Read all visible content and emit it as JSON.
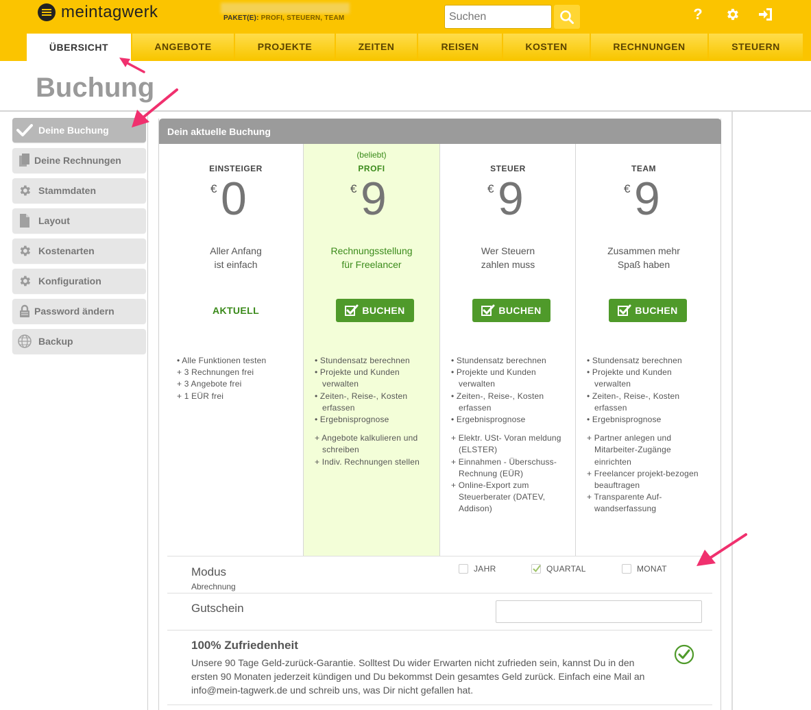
{
  "header": {
    "logo_text": "meintagwerk",
    "paket_label": "PAKET(E):",
    "paket_value": "PROFI, STEUERN, TEAM",
    "search_placeholder": "Suchen",
    "icons": [
      "help-icon",
      "gear-icon",
      "logout-icon"
    ],
    "accent_color": "#fbc400"
  },
  "nav": {
    "tabs": [
      {
        "label": "ÜBERSICHT",
        "active": true
      },
      {
        "label": "ANGEBOTE"
      },
      {
        "label": "PROJEKTE"
      },
      {
        "label": "ZEITEN"
      },
      {
        "label": "REISEN"
      },
      {
        "label": "KOSTEN"
      },
      {
        "label": "RECHNUNGEN"
      },
      {
        "label": "STEUERN"
      }
    ]
  },
  "page": {
    "title": "Buchung"
  },
  "sidebar": {
    "items": [
      {
        "label": "Deine Buchung",
        "icon": "check-icon",
        "active": true
      },
      {
        "label": "Deine Rechnungen",
        "icon": "invoices-icon"
      },
      {
        "label": "Stammdaten",
        "icon": "gear-icon"
      },
      {
        "label": "Layout",
        "icon": "document-icon"
      },
      {
        "label": "Kostenarten",
        "icon": "gear-icon"
      },
      {
        "label": "Konfiguration",
        "icon": "gear-icon"
      },
      {
        "label": "Password ändern",
        "icon": "lock-icon"
      },
      {
        "label": "Backup",
        "icon": "globe-icon"
      }
    ]
  },
  "panel": {
    "title": "Dein aktuelle Buchung",
    "plans": [
      {
        "name": "EINSTEIGER",
        "currency": "€",
        "price": "0",
        "tagline_1": "Aller Anfang",
        "tagline_2": "ist einfach",
        "status": "AKTUELL",
        "features": [
          [
            "• Alle Funktionen testen",
            "+ 3 Rechnungen frei",
            "+ 3 Angebote frei",
            "+ 1 EÜR frei"
          ]
        ]
      },
      {
        "popular": "(beliebt)",
        "name": "PROFI",
        "currency": "€",
        "price": "9",
        "tagline_1": "Rechnungsstellung",
        "tagline_2": "für Freelancer",
        "button": "BUCHEN",
        "features": [
          [
            "• Stundensatz berechnen",
            "• Projekte und Kunden verwalten",
            "• Zeiten-, Reise-, Kosten erfassen",
            "• Ergebnisprognose"
          ],
          [
            "+ Angebote kalkulieren und schreiben",
            "+ Indiv. Rechnungen stellen"
          ]
        ]
      },
      {
        "name": "STEUER",
        "currency": "€",
        "price": "9",
        "tagline_1": "Wer Steuern",
        "tagline_2": "zahlen muss",
        "button": "BUCHEN",
        "features": [
          [
            "• Stundensatz berechnen",
            "• Projekte und Kunden verwalten",
            "• Zeiten-, Reise-, Kosten erfassen",
            "• Ergebnisprognose"
          ],
          [
            "+ Elektr. USt- Voran meldung (ELSTER)",
            "+ Einnahmen - Überschuss-Rechnung (EÜR)",
            "+ Online-Export zum Steuerberater (DATEV, Addison)"
          ]
        ]
      },
      {
        "name": "TEAM",
        "currency": "€",
        "price": "9",
        "tagline_1": "Zusammen mehr",
        "tagline_2": "Spaß haben",
        "button": "BUCHEN",
        "features": [
          [
            "• Stundensatz berechnen",
            "• Projekte und Kunden verwalten",
            "• Zeiten-, Reise-, Kosten erfassen",
            "• Ergebnisprognose"
          ],
          [
            "+ Partner anlegen und Mitarbeiter-Zugänge einrichten",
            "+ Freelancer projekt-bezogen beauftragen",
            "+ Transparente Auf-wandserfassung"
          ]
        ]
      }
    ],
    "modus": {
      "label": "Modus",
      "sublabel": "Abrechnung",
      "options": [
        {
          "label": "JAHR",
          "checked": false
        },
        {
          "label": "QUARTAL",
          "checked": true
        },
        {
          "label": "MONAT",
          "checked": false
        }
      ]
    },
    "voucher": {
      "label": "Gutschein",
      "value": ""
    },
    "guarantee": {
      "title": "100% Zufriedenheit",
      "text": "Unsere 90 Tage Geld-zurück-Garantie. Solltest Du wider Erwarten nicht zufrieden sein, kannst Du in den ersten 90 Monaten jederzeit kündigen und Du bekommst Dein gesamtes Geld zurück. Einfach eine Mail an info@mein-tagwerk.de und schreib uns, was Dir nicht gefallen hat."
    }
  },
  "annotation_color": "#f0306e"
}
